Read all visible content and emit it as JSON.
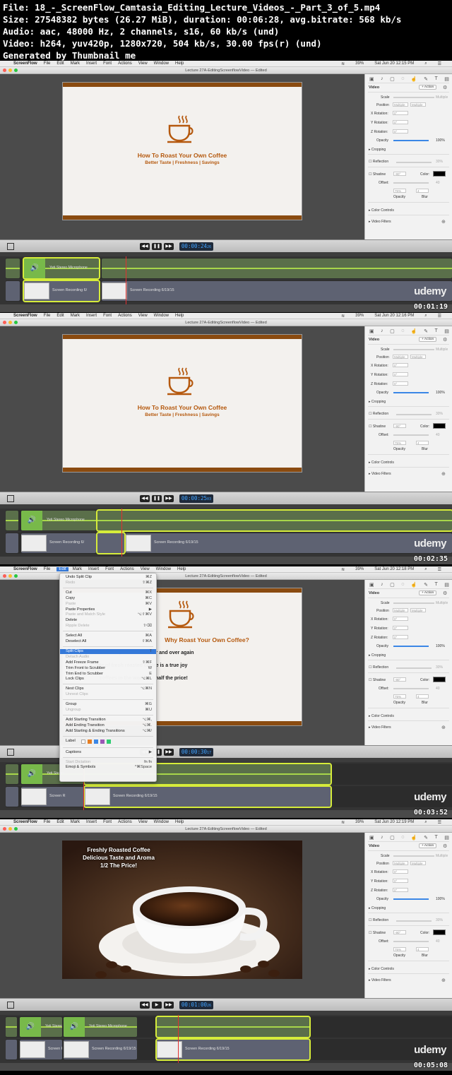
{
  "header": {
    "file": "File: 18_-_ScreenFlow_Camtasia_Editing_Lecture_Videos_-_Part_3_of_5.mp4",
    "size": "Size: 27548382 bytes (26.27 MiB), duration: 00:06:28, avg.bitrate: 568 kb/s",
    "audio": "Audio: aac, 48000 Hz, 2 channels, s16, 60 kb/s (und)",
    "video": "Video: h264, yuv420p, 1280x720, 504 kb/s, 30.00 fps(r) (und)",
    "generated": "Generated by Thumbnail me"
  },
  "menubar": {
    "app": "ScreenFlow",
    "items": [
      "File",
      "Edit",
      "Mark",
      "Insert",
      "Font",
      "Actions",
      "View",
      "Window",
      "Help"
    ],
    "battery": "39%",
    "times": [
      "Sat Jun 20 12:15 PM",
      "Sat Jun 20 12:16 PM",
      "Sat Jun 20 12:18 PM",
      "Sat Jun 20 12:19 PM"
    ]
  },
  "window": {
    "title": "Lecture 27A-EditingScreenflowVideo — Edited"
  },
  "slide": {
    "title": "How To Roast Your Own Coffee",
    "subtitle": "Better Taste | Freshness | Savings",
    "why_title": "Why Roast Your Own Coffee?",
    "why_line1": "and aromas you'll crave over and over again",
    "why_line2": "ste of fresh roasted coffee is a true joy",
    "why_line3": "coffees in the world for half the price!",
    "photo_line1": "Freshly Roasted Coffee",
    "photo_line2": "Delicious Taste and Aroma",
    "photo_line3": "1/2 The Price!"
  },
  "panel": {
    "section": "Video",
    "action_btn": "+ Action",
    "scale": "Scale",
    "position": "Position",
    "x_rotation": "X Rotation:",
    "y_rotation": "Y Rotation:",
    "z_rotation": "Z Rotation:",
    "rotation_value": "0°",
    "multiple": "Multiple",
    "opacity": "Opacity",
    "opacity_value": "100%",
    "cropping": "Cropping",
    "reflection": "Reflection",
    "reflection_value": "30%",
    "shadow": "Shadow",
    "shadow_angle": "-90°",
    "color": "Color:",
    "offset": "Offset:",
    "offset_value": "40",
    "shadow_opacity_value": "75%",
    "shadow_blur_value": "4",
    "opacity_label": "Opacity",
    "blur_label": "Blur",
    "color_controls": "Color Controls",
    "video_filters": "Video Filters"
  },
  "timecodes": [
    "00:00:24",
    "00:00:25",
    "00:00:30",
    "00:01:00"
  ],
  "timecode_frames": [
    "26",
    "03",
    "17",
    "26"
  ],
  "clips": {
    "audio_label": "Yeti Stereo Microphone",
    "audio_label_short": "Yeti Stereo",
    "video_label": "Screen Recording 6/19/15",
    "video_label_short": "Screen Recording 6/",
    "video_label_tiny": "Screen R"
  },
  "timestamps": [
    "00:01:19",
    "00:02:35",
    "00:03:52",
    "00:05:08"
  ],
  "brand": "udemy",
  "edit_menu": {
    "items": [
      {
        "label": "Undo Split Clip",
        "shortcut": "⌘Z",
        "disabled": false
      },
      {
        "label": "Redo",
        "shortcut": "⇧⌘Z",
        "disabled": true
      },
      {
        "sep": true
      },
      {
        "label": "Cut",
        "shortcut": "⌘X",
        "disabled": false
      },
      {
        "label": "Copy",
        "shortcut": "⌘C",
        "disabled": false
      },
      {
        "label": "Paste",
        "shortcut": "⌘V",
        "disabled": true
      },
      {
        "label": "Paste Properties",
        "shortcut": "▶",
        "disabled": false
      },
      {
        "label": "Paste and Match Style",
        "shortcut": "⌥⇧⌘V",
        "disabled": true
      },
      {
        "label": "Delete",
        "shortcut": "",
        "disabled": false
      },
      {
        "label": "Ripple Delete",
        "shortcut": "⇧⌫",
        "disabled": true
      },
      {
        "sep": true
      },
      {
        "label": "Select All",
        "shortcut": "⌘A",
        "disabled": false
      },
      {
        "label": "Deselect All",
        "shortcut": "⇧⌘A",
        "disabled": false
      },
      {
        "sep": true
      },
      {
        "label": "Split Clips",
        "shortcut": "T",
        "disabled": false,
        "active": true
      },
      {
        "label": "Detach Audio",
        "shortcut": "",
        "disabled": true
      },
      {
        "label": "Add Freeze Frame",
        "shortcut": "⇧⌘F",
        "disabled": false
      },
      {
        "label": "Trim Front to Scrubber",
        "shortcut": "W",
        "disabled": false
      },
      {
        "label": "Trim End to Scrubber",
        "shortcut": "E",
        "disabled": false
      },
      {
        "label": "Lock Clips",
        "shortcut": "⌥⌘L",
        "disabled": false
      },
      {
        "sep": true
      },
      {
        "label": "Nest Clips",
        "shortcut": "⌥⌘N",
        "disabled": false
      },
      {
        "label": "Unnest Clips",
        "shortcut": "",
        "disabled": true
      },
      {
        "sep": true
      },
      {
        "label": "Group",
        "shortcut": "⌘G",
        "disabled": false
      },
      {
        "label": "Ungroup",
        "shortcut": "⌘U",
        "disabled": true
      },
      {
        "sep": true
      },
      {
        "label": "Add Starting Transition",
        "shortcut": "⌥⌘,",
        "disabled": false
      },
      {
        "label": "Add Ending Transition",
        "shortcut": "⌥⌘.",
        "disabled": false
      },
      {
        "label": "Add Starting & Ending Transitions",
        "shortcut": "⌥⌘/",
        "disabled": false
      },
      {
        "sep": true
      },
      {
        "label": "Label",
        "shortcut": "",
        "disabled": false,
        "swatches": true
      },
      {
        "sep": true
      },
      {
        "label": "Captions",
        "shortcut": "▶",
        "disabled": false
      },
      {
        "sep": true
      },
      {
        "label": "Start Dictation",
        "shortcut": "fn fn",
        "disabled": true
      },
      {
        "label": "Emoji & Symbols",
        "shortcut": "^⌘Space",
        "disabled": false
      }
    ]
  },
  "colors": {
    "accent": "#3478d8",
    "selection": "#d6ec3a",
    "playhead": "#e23030",
    "slide_bar": "#8a4b10",
    "slide_text": "#b5590e",
    "audio_clip": "#78b94a"
  }
}
